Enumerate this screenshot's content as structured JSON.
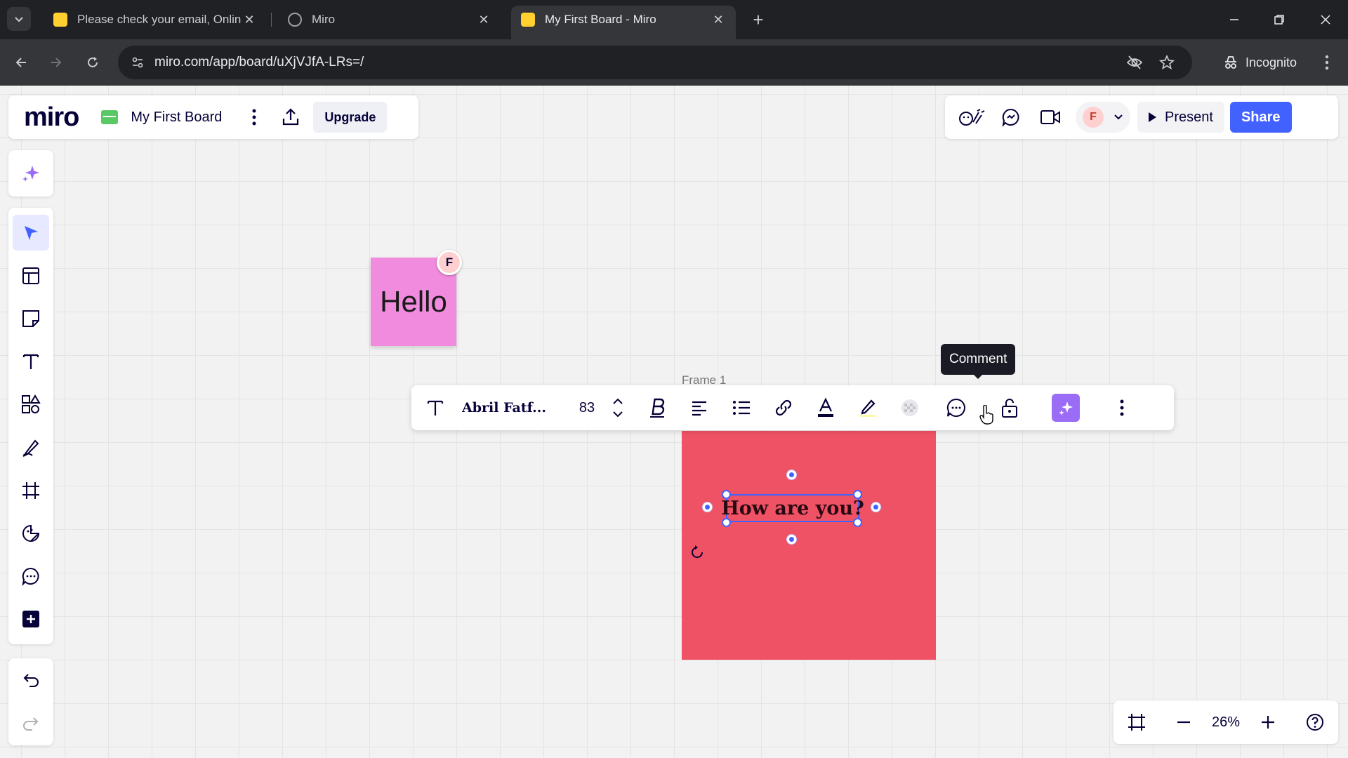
{
  "browser": {
    "tabs": [
      {
        "title": "Please check your email, Online",
        "active": false
      },
      {
        "title": "Miro",
        "active": false
      },
      {
        "title": "My First Board - Miro",
        "active": true
      }
    ],
    "url": "miro.com/app/board/uXjVJfA-LRs=/",
    "incognito_label": "Incognito"
  },
  "board_header": {
    "logo": "miro",
    "board_name": "My First Board",
    "upgrade_label": "Upgrade"
  },
  "top_right": {
    "avatar_initial": "F",
    "present_label": "Present",
    "share_label": "Share"
  },
  "canvas": {
    "sticky_text": "Hello",
    "cursor_initial": "F",
    "frame_label": "Frame 1",
    "selected_text": "How are you?"
  },
  "context_toolbar": {
    "font_name": "Abril Fatf...",
    "font_size": "83",
    "tooltip": "Comment"
  },
  "zoom": {
    "level": "26%"
  },
  "colors": {
    "accent": "#4262ff",
    "sticky": "#f08bdd",
    "frame": "#f05265",
    "ai_button": "#9b6cf5"
  },
  "icons": {
    "sidebar": [
      "ai-sparkle-icon",
      "select-arrow-icon",
      "templates-icon",
      "sticky-note-icon",
      "text-icon",
      "shapes-icon",
      "pen-icon",
      "frame-icon",
      "stickers-icon",
      "comment-icon",
      "add-icon"
    ],
    "toolbar": [
      "text-type-icon",
      "bold-icon",
      "align-left-icon",
      "bullet-list-icon",
      "link-icon",
      "text-color-icon",
      "highlight-icon",
      "fill-pattern-icon",
      "comment-icon",
      "lock-icon",
      "ai-sparkle-icon",
      "more-vertical-icon"
    ]
  }
}
